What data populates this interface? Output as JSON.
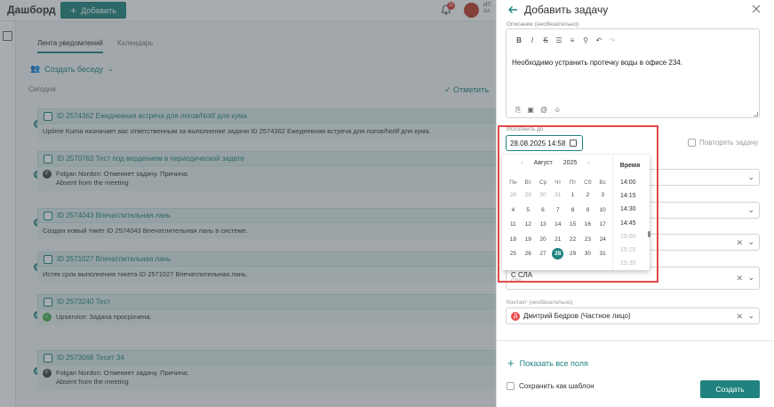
{
  "topbar": {
    "brand": "Дашборд",
    "add_label": "Добавить",
    "notif_count": "15",
    "user_line1": "ИП",
    "user_line2": "Ал"
  },
  "feed": {
    "tabs": [
      "Лента уведомлений",
      "Календарь"
    ],
    "create_conversation": "Создать беседу",
    "today": "Сегодня",
    "mark_all": "Отметить",
    "items": [
      {
        "title": "ID 2574362 Ежедневная встреча для логов/Notif для кума",
        "lines": [
          "Uptime Kuma назначает вас ответственным за выполнение задачи ID 2574362 Ежедневная встреча для логов/Notif для кума."
        ],
        "who": "",
        "who_text": ""
      },
      {
        "title": "ID 2570763 Тест под вердением в периодической задате",
        "lines": [
          "Absent from the meeting"
        ],
        "who": "Folgan Nordon:",
        "who_text": "Отменяет задачу. Причина:",
        "avatar": "F"
      },
      {
        "title": "ID 2574043 Впечатлительная лань",
        "lines": [
          "Создан новый тикет ID 2574043 Впечатлительная лань в системе."
        ],
        "who": "",
        "who_text": ""
      },
      {
        "title": "ID 2571027 Впечатлительная лань",
        "lines": [
          "Истек срок выполнения тикета ID 2571027 Впечатлительная лань."
        ],
        "who": "",
        "who_text": ""
      },
      {
        "title": "ID 2573240 Тест",
        "lines": [],
        "who": "Upservice:",
        "who_text": "Задача просрочена.",
        "avatar": "✓"
      },
      {
        "title": "ID 2573068 Тесит 34",
        "lines": [
          "Absent from the meeting"
        ],
        "who": "Folgan Nordon:",
        "who_text": "Отменяет задачу. Причина:",
        "avatar": "F"
      }
    ]
  },
  "panel": {
    "title": "Добавить задачу",
    "description_label": "Описание (необязательно)",
    "description_text": "Необходимо устранить протечку воды в офисе 234.",
    "due_label": "Исполнить до",
    "due_value": "28.08.2025 14:58",
    "repeat_label": "Повторять задачу",
    "sla_value": "С СЛА",
    "sla_sub": "СЛА",
    "contact_label": "Контакт (необязательно)",
    "contact_value": "Дмитрий Бедров (Частное лицо)",
    "contact_initial": "Д",
    "show_all_fields": "Показать все поля",
    "save_template": "Сохранить как шаблон",
    "create_button": "Создать"
  },
  "picker": {
    "month": "Август",
    "year": "2025",
    "weekdays": [
      "Пн",
      "Вт",
      "Ср",
      "Чт",
      "Пт",
      "Сб",
      "Вс"
    ],
    "days": [
      [
        "28",
        "29",
        "30",
        "31",
        "1",
        "2",
        "3"
      ],
      [
        "4",
        "5",
        "6",
        "7",
        "8",
        "9",
        "10"
      ],
      [
        "11",
        "12",
        "13",
        "14",
        "15",
        "16",
        "17"
      ],
      [
        "18",
        "19",
        "20",
        "21",
        "22",
        "23",
        "24"
      ],
      [
        "25",
        "26",
        "27",
        "28",
        "29",
        "30",
        "31"
      ]
    ],
    "selected_day": "28",
    "time_label": "Время",
    "times": [
      "14:00",
      "14:15",
      "14:30",
      "14:45",
      "15:00",
      "15:15",
      "15:30"
    ]
  },
  "colors": {
    "accent": "#20837f",
    "highlight_box": "#e04848"
  }
}
